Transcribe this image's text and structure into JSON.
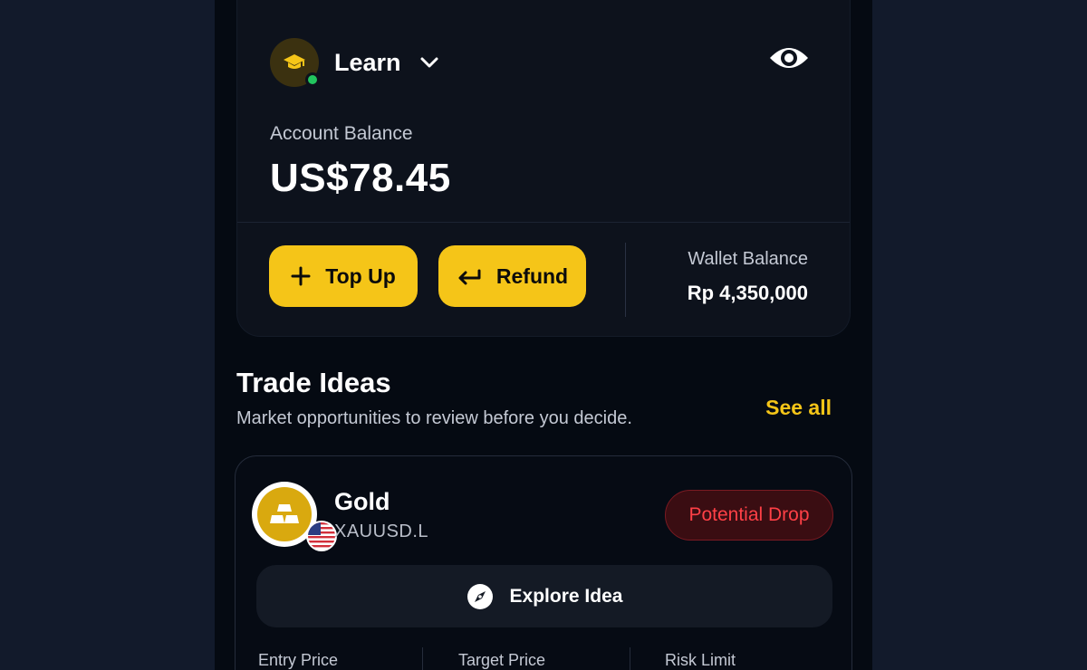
{
  "account": {
    "name": "Learn",
    "balance_label": "Account Balance",
    "balance_value": "US$78.45",
    "top_up_label": "Top Up",
    "refund_label": "Refund",
    "wallet_label": "Wallet Balance",
    "wallet_value": "Rp 4,350,000",
    "icons": {
      "avatar": "graduation-cap-icon",
      "dropdown": "chevron-down-icon",
      "visibility": "eye-icon",
      "top_up": "plus-icon",
      "refund": "arrow-left-icon"
    }
  },
  "trade_ideas": {
    "title": "Trade Ideas",
    "subtitle": "Market opportunities to review before you decide.",
    "see_all_label": "See all",
    "items": [
      {
        "name": "Gold",
        "ticker": "XAUUSD.L",
        "badge": "Potential Drop",
        "explore_label": "Explore Idea",
        "stats": [
          {
            "label": "Entry Price"
          },
          {
            "label": "Target Price"
          },
          {
            "label": "Risk Limit"
          }
        ]
      }
    ]
  },
  "colors": {
    "accent": "#f5c518",
    "background": "#050a12",
    "card": "#0d121c",
    "danger": "#ff4046",
    "online": "#22c55e"
  }
}
